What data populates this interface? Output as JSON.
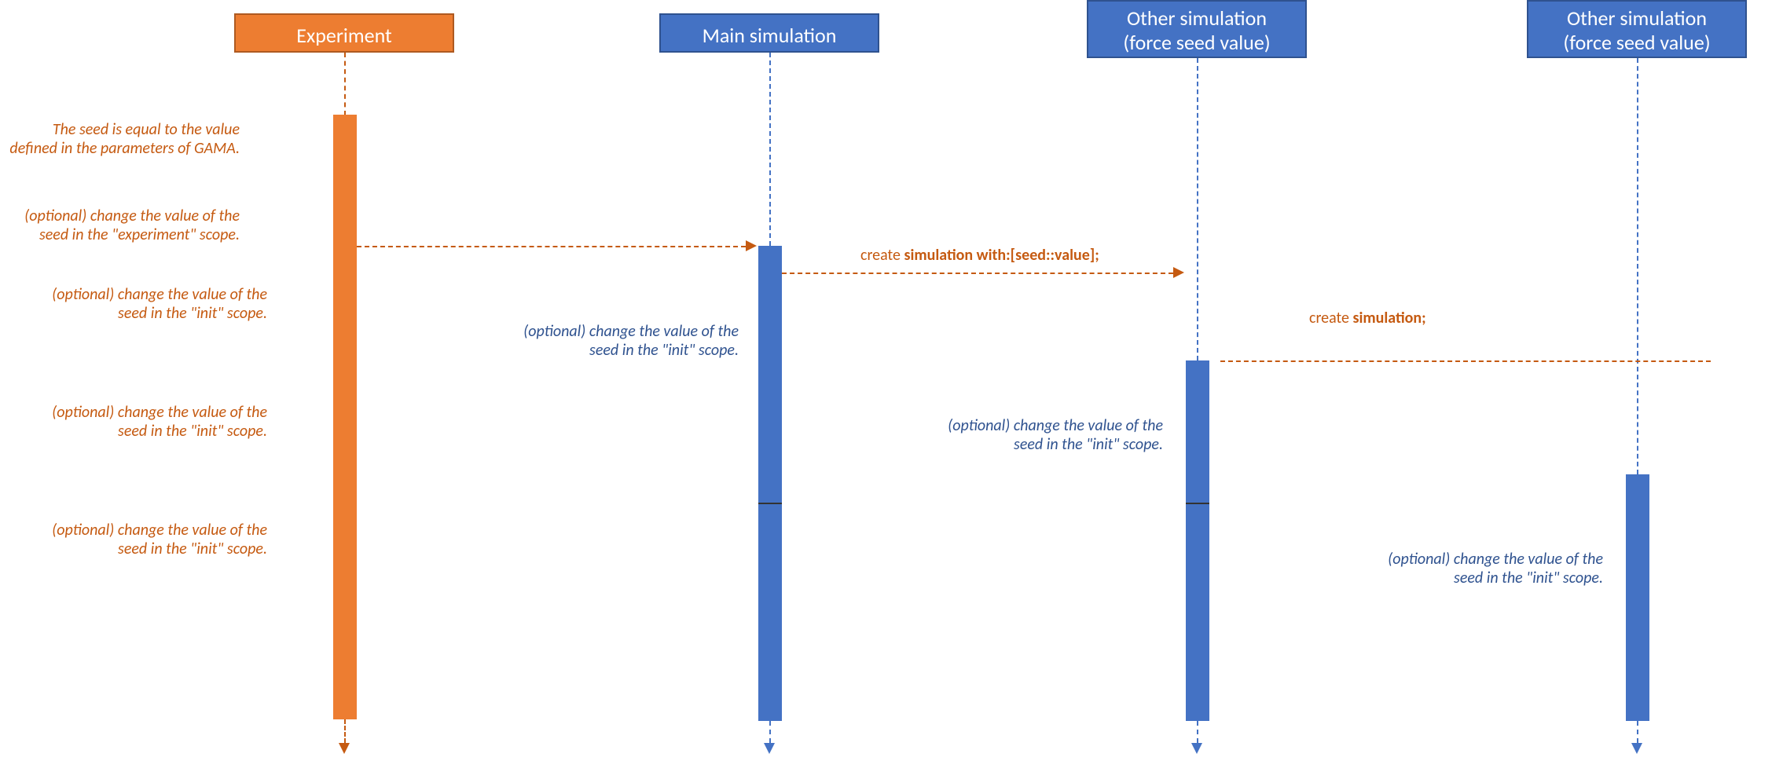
{
  "lanes": {
    "experiment": {
      "title": "Experiment"
    },
    "main_sim": {
      "title": "Main simulation"
    },
    "other_sim_force": {
      "title_line1": "Other simulation",
      "title_line2": "(force seed value)"
    },
    "other_sim_force2": {
      "title_line1": "Other simulation",
      "title_line2": "(force seed value)"
    }
  },
  "annotations": {
    "exp_seed_default": "The seed is equal to the value defined in the parameters of GAMA.",
    "exp_scope_change": "(optional) change the value of the seed in the \"experiment\" scope.",
    "init_scope_change": "(optional) change the value of the seed in the \"init\" scope."
  },
  "code": {
    "create_sim_with_seed_pre": "create ",
    "create_sim_with_seed_bold": "simulation with:[seed::value];",
    "create_sim_pre": "create ",
    "create_sim_bold": "simulation;"
  }
}
